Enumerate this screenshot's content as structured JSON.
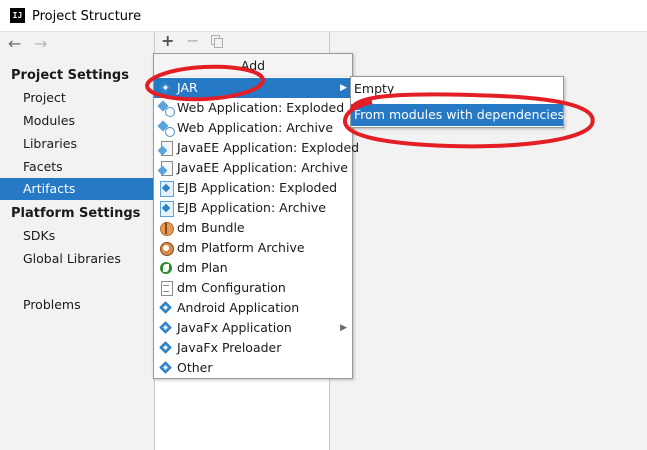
{
  "window": {
    "title": "Project Structure",
    "app_icon_text": "IJ"
  },
  "nav": {
    "back_glyph": "←",
    "forward_glyph": "→"
  },
  "sidebar": {
    "project_settings_header": "Project Settings",
    "project_items": [
      {
        "label": "Project"
      },
      {
        "label": "Modules"
      },
      {
        "label": "Libraries"
      },
      {
        "label": "Facets"
      },
      {
        "label": "Artifacts",
        "selected": true
      }
    ],
    "platform_settings_header": "Platform Settings",
    "platform_items": [
      {
        "label": "SDKs"
      },
      {
        "label": "Global Libraries"
      }
    ],
    "problems_label": "Problems"
  },
  "toolbar": {
    "add_glyph": "+",
    "remove_glyph": "−",
    "copy_icon": "copy-icon"
  },
  "add_menu": {
    "header": "Add",
    "items": [
      {
        "label": "JAR",
        "icon": "jar-icon",
        "highlighted": true,
        "submenu": true
      },
      {
        "label": "Web Application: Exploded",
        "icon": "web-app-icon"
      },
      {
        "label": "Web Application: Archive",
        "icon": "web-app-icon"
      },
      {
        "label": "JavaEE Application: Exploded",
        "icon": "javaee-icon"
      },
      {
        "label": "JavaEE Application: Archive",
        "icon": "javaee-icon"
      },
      {
        "label": "EJB Application: Exploded",
        "icon": "ejb-icon"
      },
      {
        "label": "EJB Application: Archive",
        "icon": "ejb-icon"
      },
      {
        "label": "dm Bundle",
        "icon": "bundle-icon"
      },
      {
        "label": "dm Platform Archive",
        "icon": "platform-archive-icon"
      },
      {
        "label": "dm Plan",
        "icon": "plan-icon"
      },
      {
        "label": "dm Configuration",
        "icon": "configuration-icon"
      },
      {
        "label": "Android Application",
        "icon": "android-icon"
      },
      {
        "label": "JavaFx Application",
        "icon": "javafx-icon",
        "submenu": true
      },
      {
        "label": "JavaFx Preloader",
        "icon": "javafx-icon"
      },
      {
        "label": "Other",
        "icon": "other-icon"
      }
    ]
  },
  "jar_submenu": {
    "items": [
      {
        "label": "Empty"
      },
      {
        "label": "From modules with dependencies...",
        "highlighted": true
      }
    ]
  },
  "colors": {
    "selection": "#2679c5",
    "annotation_red": "#e41e25",
    "panel_bg": "#f2f2f2",
    "list_bg": "#ffffff"
  }
}
